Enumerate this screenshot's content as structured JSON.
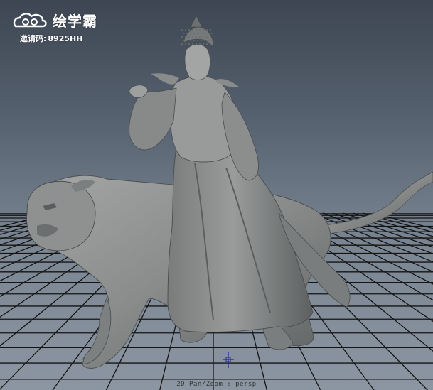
{
  "watermark": {
    "brand": "绘学霸",
    "code_label": "邀请码:",
    "code_value": "8925HH",
    "logo_icon": "cloud-swirl-logo-icon"
  },
  "viewport": {
    "hud_label": "2D Pan/Zoom : persp",
    "icons": [
      "move-manipulator-icon"
    ],
    "colors": {
      "background_top": "#3d4652",
      "background_bottom": "#8c96a2",
      "grid": "#141414",
      "model": "#8d8f8f"
    }
  }
}
